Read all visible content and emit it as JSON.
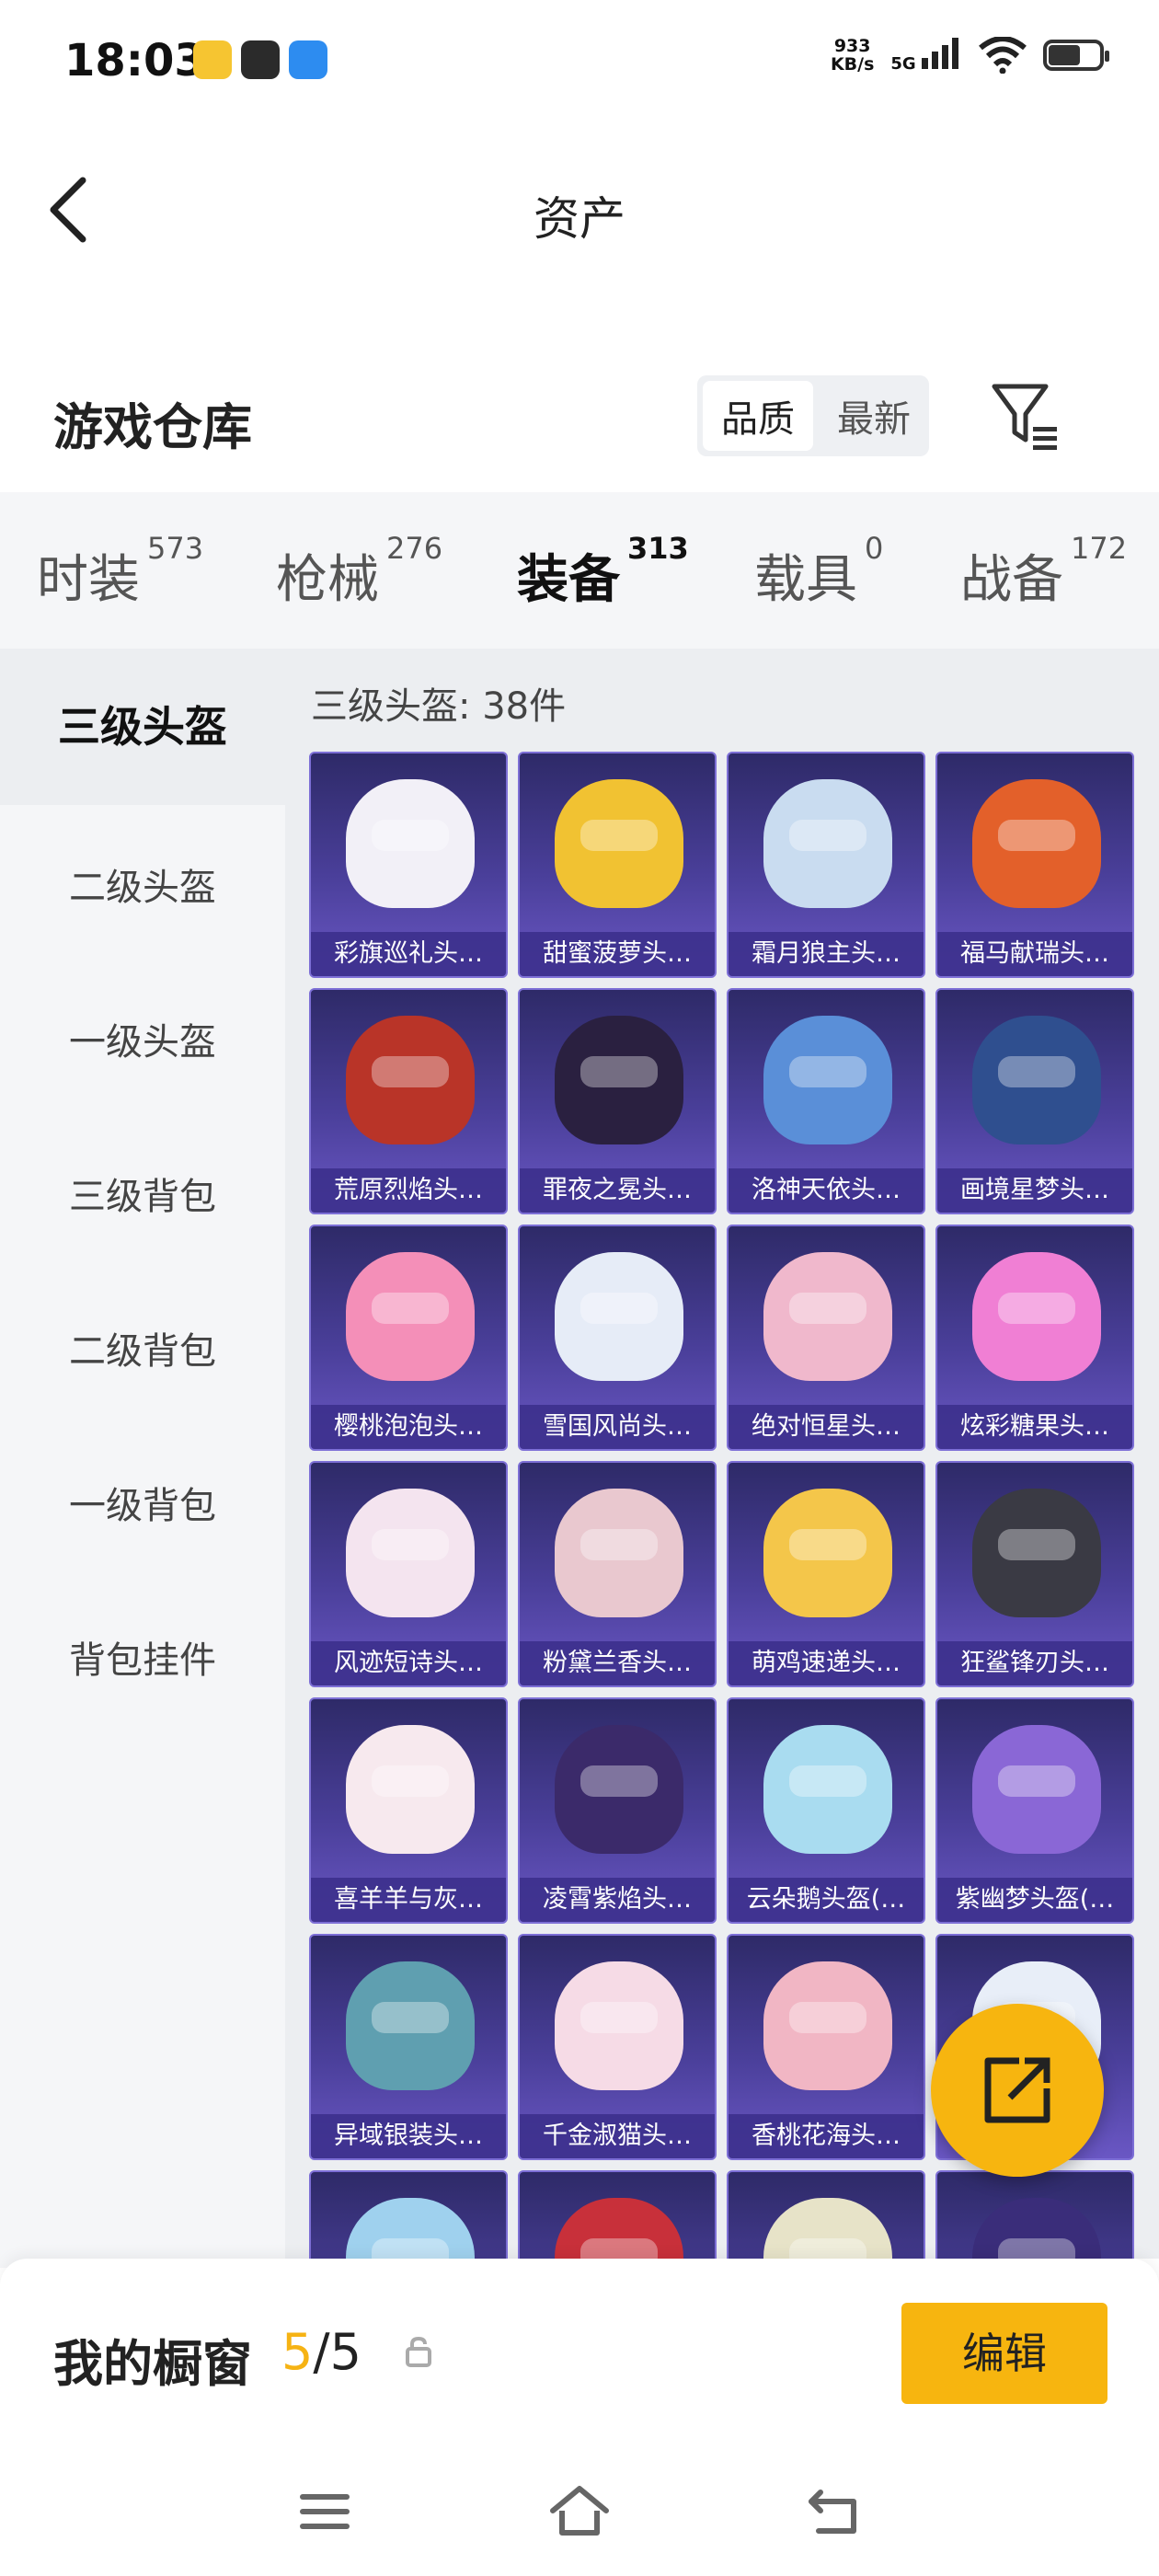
{
  "status": {
    "time": "18:03",
    "speed_value": "933",
    "speed_unit": "KB/s",
    "network": "5G"
  },
  "header": {
    "title": "资产"
  },
  "warehouse": {
    "title": "游戏仓库",
    "sort_quality": "品质",
    "sort_latest": "最新"
  },
  "categories": [
    {
      "label": "时装",
      "count": "573"
    },
    {
      "label": "枪械",
      "count": "276"
    },
    {
      "label": "装备",
      "count": "313"
    },
    {
      "label": "载具",
      "count": "0"
    },
    {
      "label": "战备",
      "count": "172"
    }
  ],
  "sidebar": {
    "items": [
      {
        "label": "三级头盔"
      },
      {
        "label": "二级头盔"
      },
      {
        "label": "一级头盔"
      },
      {
        "label": "三级背包"
      },
      {
        "label": "二级背包"
      },
      {
        "label": "一级背包"
      },
      {
        "label": "背包挂件"
      }
    ]
  },
  "content": {
    "count_label": "三级头盔: 38件",
    "items": [
      {
        "name": "彩旗巡礼头…",
        "color": "#f2f0f7"
      },
      {
        "name": "甜蜜菠萝头…",
        "color": "#f1c232"
      },
      {
        "name": "霜月狼主头…",
        "color": "#c9dcf0"
      },
      {
        "name": "福马献瑞头…",
        "color": "#e3602a"
      },
      {
        "name": "荒原烈焰头…",
        "color": "#b93428"
      },
      {
        "name": "罪夜之冕头…",
        "color": "#2a2040"
      },
      {
        "name": "洛神天依头…",
        "color": "#5a8fd8"
      },
      {
        "name": "画境星梦头…",
        "color": "#2f4f8f"
      },
      {
        "name": "樱桃泡泡头…",
        "color": "#f48fb8"
      },
      {
        "name": "雪国风尚头…",
        "color": "#e6ecf7"
      },
      {
        "name": "绝对恒星头…",
        "color": "#f0b8cc"
      },
      {
        "name": "炫彩糖果头…",
        "color": "#f07fd4"
      },
      {
        "name": "风迹短诗头…",
        "color": "#f4e4ef"
      },
      {
        "name": "粉黛兰香头…",
        "color": "#e9c8cf"
      },
      {
        "name": "萌鸡速递头…",
        "color": "#f4c64a"
      },
      {
        "name": "狂鲨锋刃头…",
        "color": "#3a3a44"
      },
      {
        "name": "喜羊羊与灰…",
        "color": "#f7e9ee"
      },
      {
        "name": "凌霄紫焰头…",
        "color": "#3b2a6a"
      },
      {
        "name": "云朵鹅头盔(…",
        "color": "#a9dcf0"
      },
      {
        "name": "紫幽梦头盔(…",
        "color": "#8a67d6"
      },
      {
        "name": "异域银装头…",
        "color": "#5f9fb0"
      },
      {
        "name": "千金淑猫头…",
        "color": "#f6dbe6"
      },
      {
        "name": "香桃花海头…",
        "color": "#f1b6c4"
      },
      {
        "name": "",
        "color": "#e8eef8"
      },
      {
        "name": "",
        "color": "#9fd1ee"
      },
      {
        "name": "",
        "color": "#c8303a"
      },
      {
        "name": "",
        "color": "#e7e3c8"
      },
      {
        "name": "",
        "color": "#3a2d7a"
      }
    ]
  },
  "showcase": {
    "title": "我的橱窗",
    "current": "5",
    "separator": "/",
    "total": "5",
    "edit_label": "编辑"
  },
  "accent_color": "#f6b314"
}
